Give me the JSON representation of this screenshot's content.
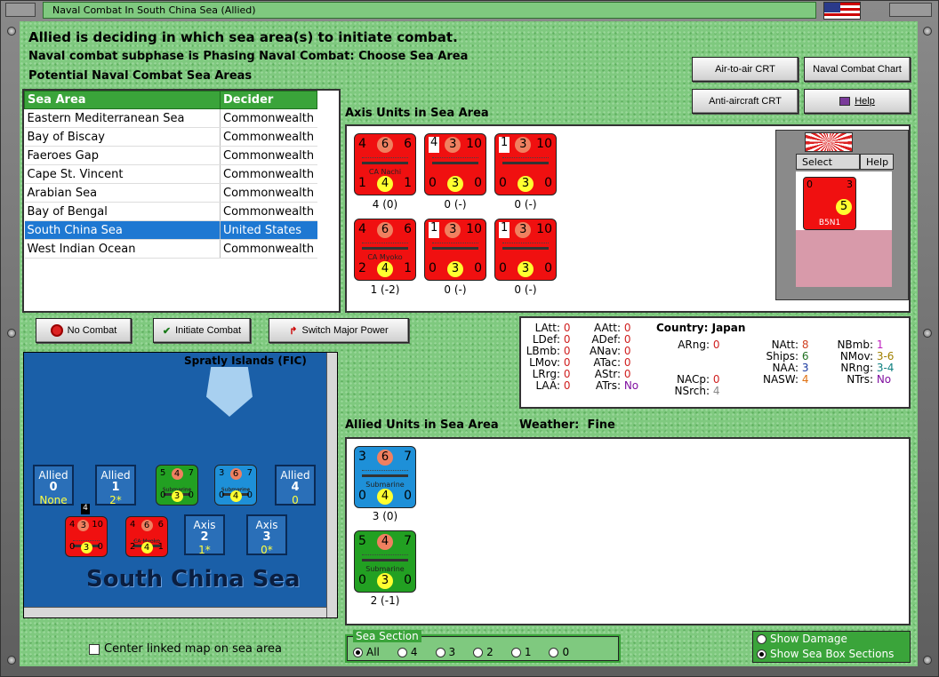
{
  "window": {
    "title": "Naval Combat In South China Sea (Allied)"
  },
  "status": {
    "line1": "Allied is deciding in which sea area(s) to initiate combat.",
    "line2": "Naval combat subphase is Phasing Naval Combat: Choose Sea Area",
    "line3": "Potential Naval Combat Sea Areas"
  },
  "buttons": {
    "air_to_air": "Air-to-air CRT",
    "naval_chart": "Naval Combat Chart",
    "anti_aircraft": "Anti-aircraft CRT",
    "help": "Help",
    "no_combat": "No Combat",
    "initiate_combat": "Initiate Combat",
    "switch_power": "Switch Major Power"
  },
  "sea_table": {
    "headers": [
      "Sea Area",
      "Decider"
    ],
    "rows": [
      [
        "Eastern Mediterranean Sea",
        "Commonwealth"
      ],
      [
        "Bay of Biscay",
        "Commonwealth"
      ],
      [
        "Faeroes Gap",
        "Commonwealth"
      ],
      [
        "Cape St. Vincent",
        "Commonwealth"
      ],
      [
        "Arabian Sea",
        "Commonwealth"
      ],
      [
        "Bay of Bengal",
        "Commonwealth"
      ],
      [
        "South China Sea",
        "United States"
      ],
      [
        "West Indian Ocean",
        "Commonwealth"
      ]
    ],
    "selected_index": 6
  },
  "axis": {
    "heading": "Axis Units in Sea Area",
    "units": [
      {
        "tl": "4",
        "tc": "6",
        "tr": "6",
        "bl": "1",
        "bc": "4",
        "br": "1",
        "name": "CA Nachi",
        "cap": "4 (0)",
        "box": false
      },
      {
        "tl": "4",
        "tc": "3",
        "tr": "10",
        "bl": "0",
        "bc": "3",
        "br": "0",
        "name": "",
        "cap": "0 (-)",
        "box": true
      },
      {
        "tl": "1",
        "tc": "3",
        "tr": "10",
        "bl": "0",
        "bc": "3",
        "br": "0",
        "name": "",
        "cap": "0 (-)",
        "box": true
      },
      {
        "tl": "4",
        "tc": "6",
        "tr": "6",
        "bl": "2",
        "bc": "4",
        "br": "1",
        "name": "CA Myoko",
        "cap": "1 (-2)",
        "box": false
      },
      {
        "tl": "1",
        "tc": "3",
        "tr": "10",
        "bl": "0",
        "bc": "3",
        "br": "0",
        "name": "",
        "cap": "0 (-)",
        "box": true
      },
      {
        "tl": "1",
        "tc": "3",
        "tr": "10",
        "bl": "0",
        "bc": "3",
        "br": "0",
        "name": "",
        "cap": "0 (-)",
        "box": true
      }
    ]
  },
  "carrier_panel": {
    "select": "Select",
    "help": "Help",
    "unit_name": "B5N1",
    "unit_top": "0",
    "unit_top_r": "3",
    "unit_value": "5"
  },
  "stats": {
    "country_label": "Country:",
    "country": "Japan",
    "col1": [
      [
        "LAtt:",
        "0"
      ],
      [
        "LDef:",
        "0"
      ],
      [
        "LBmb:",
        "0"
      ],
      [
        "LMov:",
        "0"
      ],
      [
        "LRrg:",
        "0"
      ],
      [
        "LAA:",
        "0"
      ]
    ],
    "col2": [
      [
        "AAtt:",
        "0"
      ],
      [
        "ADef:",
        "0"
      ],
      [
        "ANav:",
        "0"
      ],
      [
        "ATac:",
        "0"
      ],
      [
        "AStr:",
        "0"
      ],
      [
        "ATrs:",
        "No"
      ]
    ],
    "col3": [
      [
        "ARng:",
        "0"
      ],
      [
        "NACp:",
        "0"
      ],
      [
        "NSrch:",
        "4"
      ]
    ],
    "col4": [
      [
        "NAtt:",
        "8"
      ],
      [
        "Ships:",
        "6"
      ],
      [
        "NAA:",
        "3"
      ],
      [
        "NASW:",
        "4"
      ]
    ],
    "col5": [
      [
        "NBmb:",
        "1"
      ],
      [
        "NMov:",
        "3-6"
      ],
      [
        "NRng:",
        "3-4"
      ],
      [
        "NTrs:",
        "No"
      ]
    ]
  },
  "allied": {
    "heading": "Allied Units in Sea Area",
    "weather_label": "Weather:",
    "weather": "Fine",
    "units": [
      {
        "tl": "3",
        "tc": "6",
        "tr": "7",
        "bl": "0",
        "bc": "4",
        "br": "0",
        "name": "Submarine",
        "cap": "3 (0)",
        "color": "#1e90d8"
      },
      {
        "tl": "5",
        "tc": "4",
        "tr": "7",
        "bl": "0",
        "bc": "3",
        "br": "0",
        "name": "Submarine",
        "cap": "2 (-1)",
        "color": "#22a022"
      }
    ]
  },
  "map": {
    "island_label": "Spratly Islands (FIC)",
    "sea_name": "South China Sea",
    "boxes": [
      {
        "title": "Allied",
        "num": "0",
        "sub": "None"
      },
      {
        "title": "Allied",
        "num": "1",
        "sub": "2*"
      },
      {
        "title": "Allied",
        "num": "4",
        "sub": "0"
      },
      {
        "title": "Axis",
        "num": "2",
        "sub": "1*"
      },
      {
        "title": "Axis",
        "num": "3",
        "sub": "0*"
      }
    ],
    "stack_count": "4",
    "mini_units": [
      {
        "tl": "5",
        "tc": "4",
        "tr": "7",
        "bl": "0",
        "bc": "3",
        "br": "0",
        "name": "Submarine"
      },
      {
        "tl": "3",
        "tc": "6",
        "tr": "7",
        "bl": "0",
        "bc": "4",
        "br": "0",
        "name": "Submarine"
      },
      {
        "tl": "4",
        "tc": "3",
        "tr": "10",
        "bl": "0",
        "bc": "3",
        "br": "0",
        "name": ""
      },
      {
        "tl": "4",
        "tc": "6",
        "tr": "6",
        "bl": "2",
        "bc": "4",
        "br": "1",
        "name": "CA Myoko"
      }
    ]
  },
  "options": {
    "center_map": "Center linked map on sea area",
    "sea_section": "Sea Section",
    "sections": [
      "All",
      "4",
      "3",
      "2",
      "1",
      "0"
    ],
    "show_damage": "Show Damage",
    "show_sections": "Show Sea Box Sections"
  },
  "colors": {
    "felt": "#7fc97f",
    "axis_red": "#f01010",
    "select_blue": "#1e78d2",
    "header_green": "#3aa43a"
  }
}
